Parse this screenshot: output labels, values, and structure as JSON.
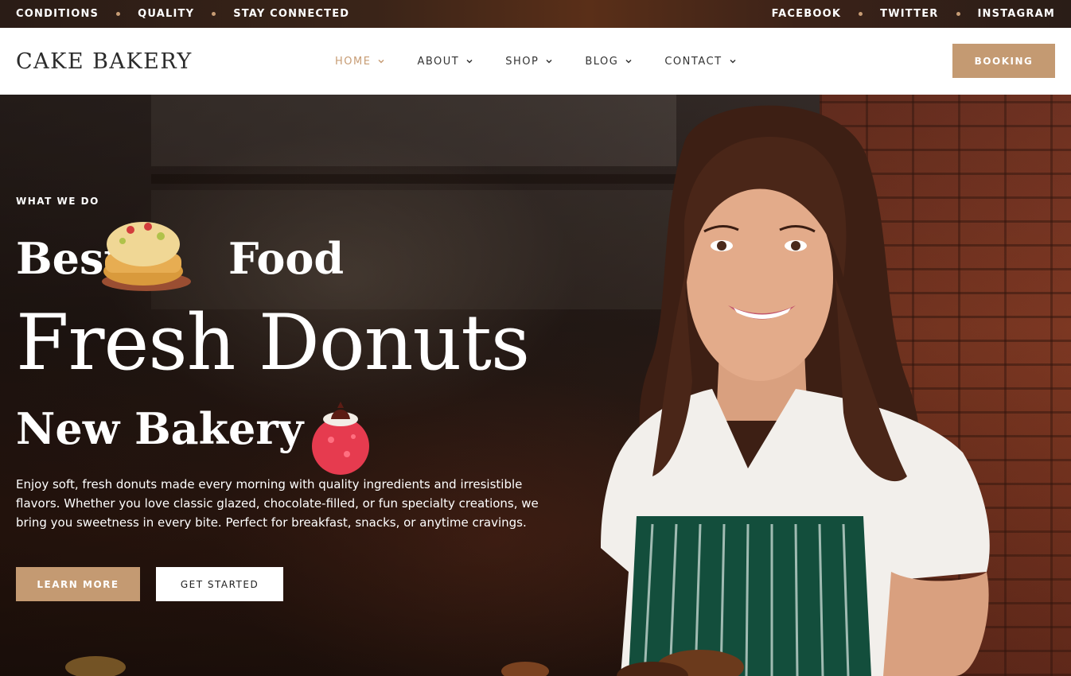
{
  "topbar": {
    "left_links": [
      "CONDITIONS",
      "QUALITY",
      "STAY CONNECTED"
    ],
    "right_links": [
      "FACEBOOK",
      "TWITTER",
      "INSTAGRAM"
    ]
  },
  "header": {
    "logo": "CAKE BAKERY",
    "nav": [
      {
        "label": "HOME",
        "active": true
      },
      {
        "label": "ABOUT",
        "active": false
      },
      {
        "label": "SHOP",
        "active": false
      },
      {
        "label": "BLOG",
        "active": false
      },
      {
        "label": "CONTACT",
        "active": false
      }
    ],
    "booking_label": "BOOKING"
  },
  "hero": {
    "eyebrow": "WHAT WE DO",
    "line1_a": "Best",
    "line1_b": "Food",
    "line2": "Fresh Donuts",
    "line3": "New Bakery",
    "description": "Enjoy soft, fresh donuts made every morning with quality ingredients and irresistible flavors. Whether you love classic glazed, chocolate-filled, or fun specialty creations, we bring you sweetness in every bite. Perfect for breakfast, snacks, or anytime cravings.",
    "primary_button": "LEARN MORE",
    "secondary_button": "GET STARTED"
  },
  "colors": {
    "accent": "#c49a72",
    "topbar_dot": "#c79c74",
    "header_bg": "#ffffff"
  },
  "icons": {
    "nav_chevron": "chevron-down-icon",
    "cake_decoration": "cake-icon",
    "pastry_decoration": "pastry-icon"
  }
}
